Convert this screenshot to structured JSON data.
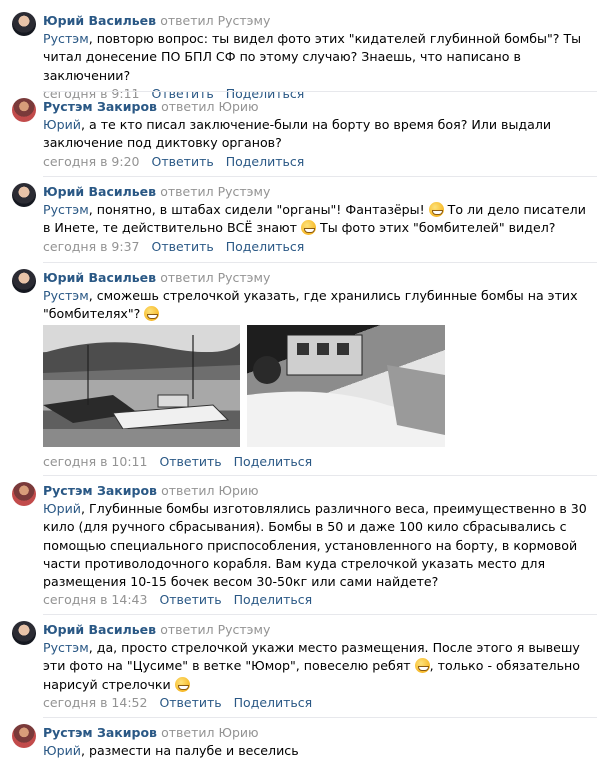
{
  "comments": [
    {
      "author": "Юрий Васильев",
      "replied": "ответил Рустэму",
      "mention": "Рустэм",
      "text": ", повторю вопрос: ты видел фото этих \"кидателей глубинной бомбы\"? Ты читал донесение ПО БПЛ СФ по этому случаю? Знаешь, что написано в заключении?",
      "time": "сегодня в 9:11",
      "reply": "Ответить",
      "share": "Поделиться"
    },
    {
      "author": "Рустэм Закиров",
      "replied": "ответил Юрию",
      "mention": "Юрий",
      "text": ", а те кто писал заключение-были на борту во время боя? Или выдали заключение под диктовку органов?",
      "time": "сегодня в 9:20",
      "reply": "Ответить",
      "share": "Поделиться"
    },
    {
      "author": "Юрий Васильев",
      "replied": "ответил Рустэму",
      "mention": "Рустэм",
      "text_a": ", понятно, в штабах сидели \"органы\"! Фантазёры! ",
      "text_b": " То ли дело писатели в Инете, те действительно ВСЁ знают ",
      "text_c": " Ты фото этих \"бомбителей\" видел?",
      "time": "сегодня в 9:37",
      "reply": "Ответить",
      "share": "Поделиться"
    },
    {
      "author": "Юрий Васильев",
      "replied": "ответил Рустэму",
      "mention": "Рустэм",
      "text_a": ", сможешь стрелочкой указать, где хранились глубинные бомбы на этих \"бомбителях\"? ",
      "time": "сегодня в 10:11",
      "reply": "Ответить",
      "share": "Поделиться"
    },
    {
      "author": "Рустэм Закиров",
      "replied": "ответил Юрию",
      "mention": "Юрий",
      "text": ", Глубинные бомбы изготовлялись различного веса, преимущественно в 30 кило (для ручного сбрасывания). Бомбы в 50 и даже 100 кило сбрасывались с помощью специального приспособления, установленного на борту, в кормовой части противолодочного корабля. Вам куда стрелочкой указать место для размещения 10-15 бочек весом 30-50кг или сами найдете?",
      "time": "сегодня в 14:43",
      "reply": "Ответить",
      "share": "Поделиться"
    },
    {
      "author": "Юрий Васильев",
      "replied": "ответил Рустэму",
      "mention": "Рустэм",
      "text_a": ", да, просто стрелочкой укажи место размещения. После этого я вывешу эти фото на \"Цусиме\" в ветке \"Юмор\", повеселю ребят ",
      "text_b": ", только - обязательно нарисуй стрелочки ",
      "time": "сегодня в 14:52",
      "reply": "Ответить",
      "share": "Поделиться"
    },
    {
      "author": "Рустэм Закиров",
      "replied": "ответил Юрию",
      "mention": "Юрий",
      "text": ", размести на палубе и веселись"
    }
  ],
  "icons": {
    "emoji": "grinning-face-emoji",
    "avatar_yuri": "avatar-yuri",
    "avatar_rustem": "avatar-rustem"
  },
  "colors": {
    "link": "#2a5885",
    "muted": "#939393",
    "divider": "#e7e8ec"
  }
}
